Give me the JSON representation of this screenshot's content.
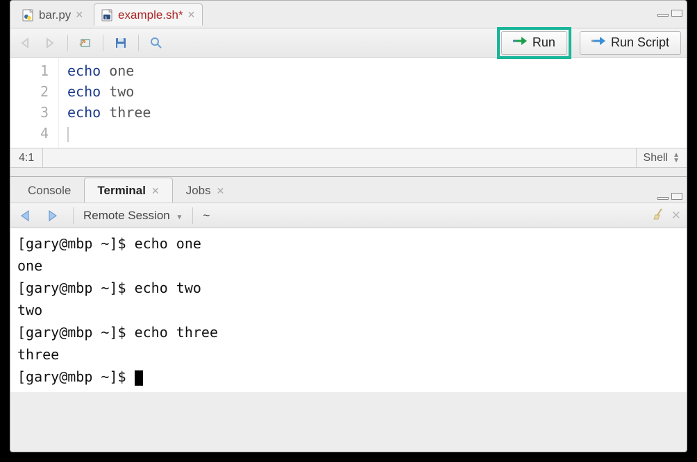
{
  "editor": {
    "tabs": [
      {
        "label": "bar.py",
        "active": false,
        "icon": "python"
      },
      {
        "label": "example.sh*",
        "active": true,
        "icon": "shell"
      }
    ],
    "toolbar": {
      "run_label": "Run",
      "run_script_label": "Run Script"
    },
    "code": {
      "lines": [
        {
          "n": "1",
          "kw": "echo",
          "rest": " one"
        },
        {
          "n": "2",
          "kw": "echo",
          "rest": " two"
        },
        {
          "n": "3",
          "kw": "echo",
          "rest": " three"
        },
        {
          "n": "4",
          "kw": "",
          "rest": ""
        }
      ]
    },
    "status": {
      "position": "4:1",
      "language": "Shell"
    }
  },
  "bottom": {
    "tabs": [
      {
        "label": "Console",
        "active": false,
        "closable": false
      },
      {
        "label": "Terminal",
        "active": true,
        "closable": true
      },
      {
        "label": "Jobs",
        "active": false,
        "closable": true
      }
    ],
    "toolbar": {
      "session": "Remote Session",
      "cwd": "~"
    },
    "terminal_lines": [
      "[gary@mbp ~]$ echo one",
      "one",
      "[gary@mbp ~]$ echo two",
      "two",
      "[gary@mbp ~]$ echo three",
      "three",
      "[gary@mbp ~]$ "
    ]
  }
}
